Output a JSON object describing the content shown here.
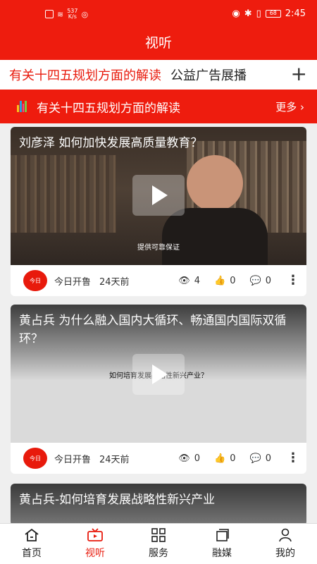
{
  "status_bar": {
    "speed_value": "537",
    "speed_unit": "K/s",
    "battery": "68",
    "time": "2:45"
  },
  "header": {
    "title": "视听"
  },
  "tabs": {
    "items": [
      {
        "label": "有关十四五规划方面的解读"
      },
      {
        "label": "公益广告展播"
      }
    ],
    "add_label": "+"
  },
  "section": {
    "title": "有关十四五规划方面的解读",
    "more_label": "更多 ›"
  },
  "cards": [
    {
      "title": "刘彦泽 如何加快发展高质量教育？",
      "caption": "提供可靠保证",
      "avatar_text": "今日",
      "source": "今日开鲁",
      "age": "24天前",
      "views": "4",
      "likes": "0",
      "comments": "0"
    },
    {
      "title": "黄占兵 为什么融入国内大循环、畅通国内国际双循环？",
      "caption": "如何培育发展战略性新兴产业？",
      "avatar_text": "今日",
      "source": "今日开鲁",
      "age": "24天前",
      "views": "0",
      "likes": "0",
      "comments": "0"
    },
    {
      "title": "黄占兵-如何培育发展战略性新兴产业"
    }
  ],
  "bottom_nav": {
    "items": [
      {
        "label": "首页",
        "icon": "home-icon"
      },
      {
        "label": "视听",
        "icon": "tv-icon"
      },
      {
        "label": "服务",
        "icon": "grid-icon"
      },
      {
        "label": "融媒",
        "icon": "media-icon"
      },
      {
        "label": "我的",
        "icon": "user-icon"
      }
    ]
  },
  "colors": {
    "brand_red": "#ee1c0e",
    "active_red": "#e81a0c"
  }
}
